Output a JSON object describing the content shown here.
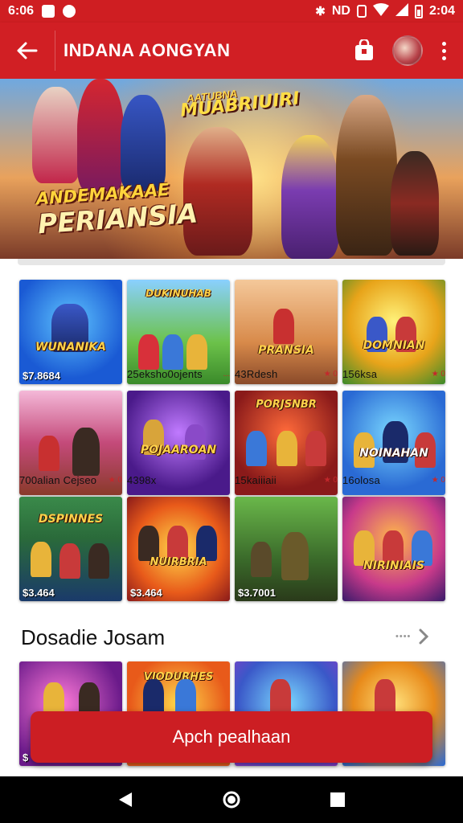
{
  "status_bar": {
    "time_left": "6:06",
    "time_right": "2:04",
    "network": "ND"
  },
  "app_bar": {
    "title": "INDANA AONGYAN",
    "icons": [
      "back-arrow-icon",
      "shopping-bag-icon",
      "avatar",
      "more-vert-icon"
    ]
  },
  "banner": {
    "tag": "AATUBNA",
    "subtitle": "MUABRIUIRI",
    "title_line1": "ANDEMAKAAE",
    "title_line2": "PERIANSIA"
  },
  "grid": {
    "row1": [
      {
        "label": "WUNANIKA",
        "price": "$7.8684"
      },
      {
        "label": "DUKINUHAB",
        "price": ""
      },
      {
        "label": "PRANSIA",
        "price": ""
      },
      {
        "label": "DOMNIAN",
        "price": ""
      }
    ],
    "row1_info": [
      {
        "text": "",
        "rating": ""
      },
      {
        "text": "25eksho0ojents",
        "rating": "..."
      },
      {
        "text": "43Rdesh",
        "rating": "★ 0"
      },
      {
        "text": "156ksa",
        "rating": "★ 0"
      }
    ],
    "row2": [
      {
        "label": "",
        "price": ""
      },
      {
        "label": "POJAAROAN",
        "price": ""
      },
      {
        "label": "PORJSNBR",
        "price": ""
      },
      {
        "label": "NOINAHAN",
        "price": ""
      }
    ],
    "row2_info": [
      {
        "text": "700alian Cejseo",
        "rating": "★ 0"
      },
      {
        "text": "4398x",
        "rating": ""
      },
      {
        "text": "15kaiiiaii",
        "rating": "★ 0"
      },
      {
        "text": "16olosa",
        "rating": "★ 0"
      }
    ],
    "row3": [
      {
        "label": "DSPINNES",
        "price": "$3.464"
      },
      {
        "label": "NUIRBRIA",
        "price": "$3.464"
      },
      {
        "label": "",
        "price": "$3.7001"
      },
      {
        "label": "NIRINIAIS",
        "price": ""
      }
    ]
  },
  "section": {
    "title": "Dosadie Josam",
    "more_dots": "••••"
  },
  "bottom_row": [
    {
      "label": "",
      "price": "$"
    },
    {
      "label": "VIODURHES",
      "price": ""
    },
    {
      "label": "",
      "price": ""
    },
    {
      "label": "",
      "price": ""
    }
  ],
  "cta": {
    "label": "Apch pealhaan"
  },
  "colors": {
    "primary": "#d11f24",
    "cta": "#cc1e23",
    "status_bar": "#cf1e22"
  }
}
